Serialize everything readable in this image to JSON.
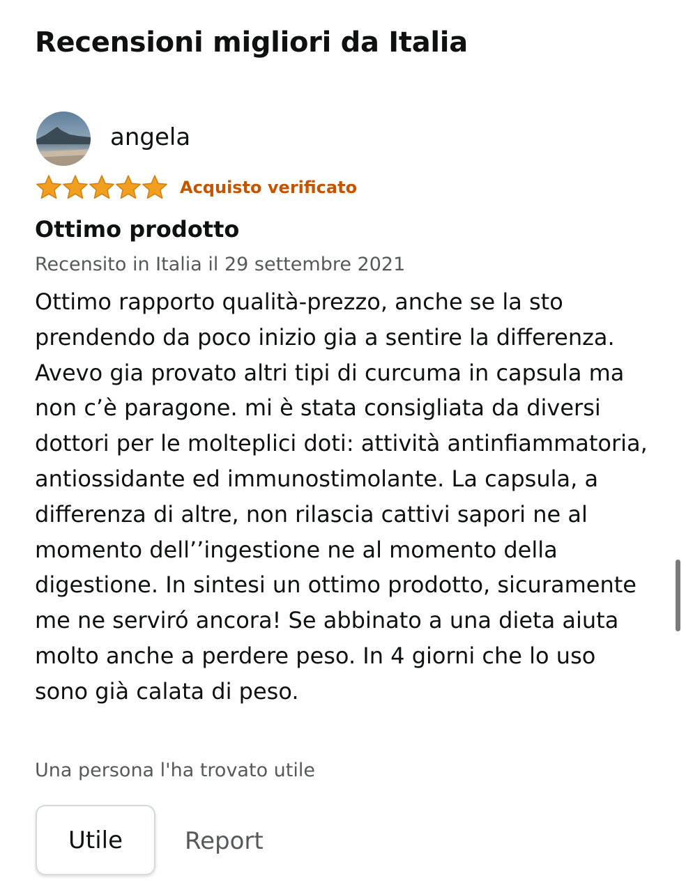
{
  "section": {
    "title": "Recensioni migliori da Italia"
  },
  "review": {
    "reviewer_name": "angela",
    "avatar_icon": "profile-photo-avatar",
    "rating": 5,
    "rating_max": 5,
    "star_color": "#f29e1f",
    "verified_label": "Acquisto verificato",
    "verified_color": "#c45500",
    "title": "Ottimo prodotto",
    "date": "Recensito in Italia il 29 settembre 2021",
    "body": "Ottimo rapporto qualità-prezzo, anche se la sto prendendo da poco inizio gia a sentire la differenza. Avevo gia provato altri tipi di curcuma in capsula ma non c’è paragone. mi è stata consigliata da diversi dottori per le molteplici doti: attività antinfiammatoria, antiossidante ed immunostimolante. La capsula, a differenza di altre, non rilascia cattivi sapori ne al momento dell’’ingestione ne al momento della digestione. In sintesi un ottimo prodotto, sicuramente me ne serviró ancora! Se abbinato a una dieta aiuta molto anche a perdere peso. In 4 giorni che lo uso sono già calata di peso.",
    "helpful_text": "Una persona l'ha trovato utile"
  },
  "actions": {
    "helpful_label": "Utile",
    "report_label": "Report"
  }
}
